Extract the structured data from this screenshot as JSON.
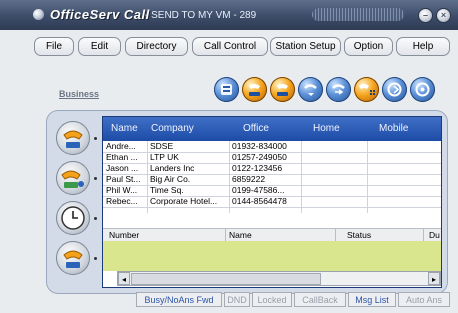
{
  "window": {
    "brand": "OfficeServ Call",
    "subtitle": "- SEND TO MY VM - 289",
    "minimize": "–",
    "close": "×"
  },
  "menu": [
    "File",
    "Edit",
    "Directory",
    "Call Control",
    "Station Setup",
    "Option",
    "Help"
  ],
  "toolbar": {
    "group_label": "Business",
    "icons": [
      "phonebook-icon",
      "handset-icon",
      "handset-icon",
      "call-arrow-icon",
      "transfer-icon",
      "handset-keypad-icon",
      "forward-icon",
      "voicemail-icon"
    ]
  },
  "directory": {
    "columns": [
      "Name",
      "Company",
      "Office",
      "Home",
      "Mobile"
    ],
    "rows": [
      {
        "name": "Andre...",
        "company": "SDSE",
        "office": "01932-834000",
        "home": "",
        "mobile": ""
      },
      {
        "name": "Ethan ...",
        "company": "LTP UK",
        "office": "01257-249050",
        "home": "",
        "mobile": ""
      },
      {
        "name": "Jason ...",
        "company": "Landers Inc",
        "office": "0122-123456",
        "home": "",
        "mobile": ""
      },
      {
        "name": "Paul St...",
        "company": "Big Air Co.",
        "office": "6859222",
        "home": "",
        "mobile": ""
      },
      {
        "name": "Phil W...",
        "company": "Time Sq.",
        "office": "0199-47586...",
        "home": "",
        "mobile": ""
      },
      {
        "name": "Rebec...",
        "company": "Corporate Hotel...",
        "office": "0144-8564478",
        "home": "",
        "mobile": ""
      }
    ]
  },
  "calls": {
    "columns": [
      "Number",
      "Name",
      "Status",
      "Du"
    ]
  },
  "scroll": {
    "left": "◂",
    "right": "▸"
  },
  "status": {
    "items": [
      {
        "label": "Busy/NoAns Fwd",
        "active": true
      },
      {
        "label": "DND",
        "active": false
      },
      {
        "label": "Locked",
        "active": false
      },
      {
        "label": "CallBack",
        "active": false
      },
      {
        "label": "Msg List",
        "active": true
      },
      {
        "label": "Auto Ans",
        "active": false
      }
    ]
  }
}
